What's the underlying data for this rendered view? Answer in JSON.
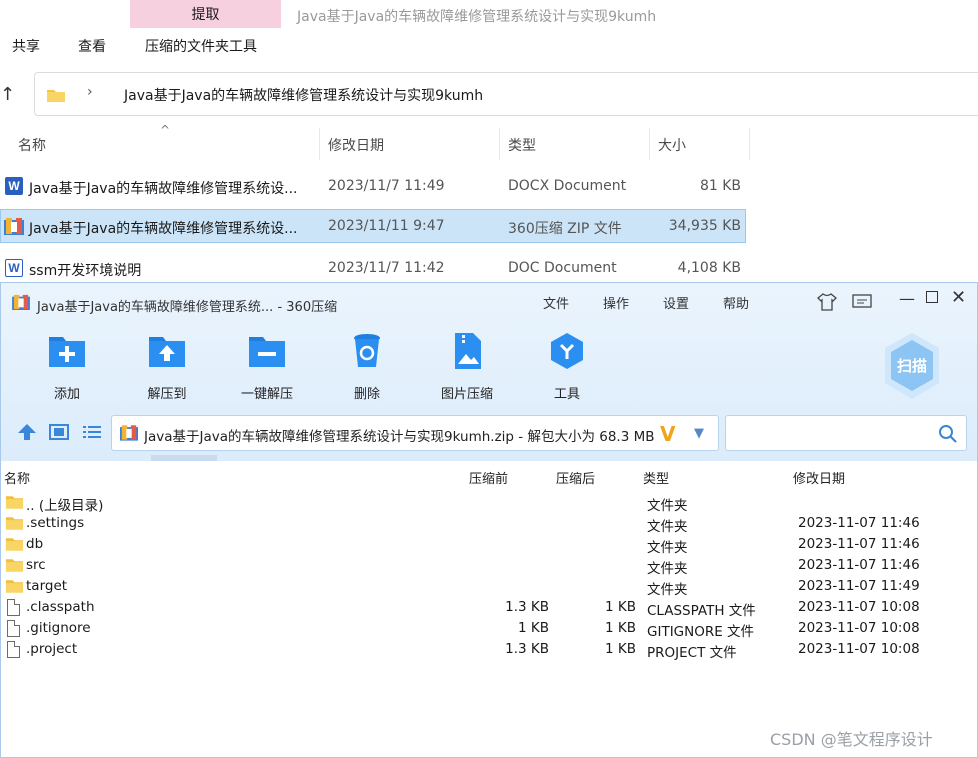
{
  "explorer": {
    "extract_tab": "提取",
    "window_title": "Java基于Java的车辆故障维修管理系统设计与实现9kumh",
    "menu": [
      "共享",
      "查看",
      "压缩的文件夹工具"
    ],
    "address_path": "Java基于Java的车辆故障维修管理系统设计与实现9kumh",
    "columns": [
      "名称",
      "修改日期",
      "类型",
      "大小"
    ],
    "files": [
      {
        "name": "Java基于Java的车辆故障维修管理系统设...",
        "date": "2023/11/7 11:49",
        "type": "DOCX Document",
        "size": "81 KB",
        "icon": "word-icon"
      },
      {
        "name": "Java基于Java的车辆故障维修管理系统设...",
        "date": "2023/11/11 9:47",
        "type": "360压缩 ZIP 文件",
        "size": "34,935 KB",
        "icon": "zip-icon"
      },
      {
        "name": "ssm开发环境说明",
        "date": "2023/11/7 11:42",
        "type": "DOC Document",
        "size": "4,108 KB",
        "icon": "doc-icon"
      }
    ]
  },
  "zip": {
    "title": "Java基于Java的车辆故障维修管理系统... - 360压缩",
    "menu": [
      "文件",
      "操作",
      "设置",
      "帮助"
    ],
    "toolbar": [
      "添加",
      "解压到",
      "一键解压",
      "删除",
      "图片压缩",
      "工具"
    ],
    "scan_label": "扫描",
    "path_text": "Java基于Java的车辆故障维修管理系统设计与实现9kumh.zip - 解包大小为 68.3 MB",
    "columns": [
      "名称",
      "压缩前",
      "压缩后",
      "类型",
      "修改日期"
    ],
    "rows": [
      {
        "name": ".. (上级目录)",
        "before": "",
        "after": "",
        "type": "文件夹",
        "date": "",
        "icon": "folder-icon"
      },
      {
        "name": ".settings",
        "before": "",
        "after": "",
        "type": "文件夹",
        "date": "2023-11-07 11:46",
        "icon": "folder-icon"
      },
      {
        "name": "db",
        "before": "",
        "after": "",
        "type": "文件夹",
        "date": "2023-11-07 11:46",
        "icon": "folder-icon"
      },
      {
        "name": "src",
        "before": "",
        "after": "",
        "type": "文件夹",
        "date": "2023-11-07 11:46",
        "icon": "folder-icon"
      },
      {
        "name": "target",
        "before": "",
        "after": "",
        "type": "文件夹",
        "date": "2023-11-07 11:49",
        "icon": "folder-icon"
      },
      {
        "name": ".classpath",
        "before": "1.3 KB",
        "after": "1 KB",
        "type": "CLASSPATH 文件",
        "date": "2023-11-07 10:08",
        "icon": "file-icon"
      },
      {
        "name": ".gitignore",
        "before": "1 KB",
        "after": "1 KB",
        "type": "GITIGNORE 文件",
        "date": "2023-11-07 10:08",
        "icon": "file-icon"
      },
      {
        "name": ".project",
        "before": "1.3 KB",
        "after": "1 KB",
        "type": "PROJECT 文件",
        "date": "2023-11-07 10:08",
        "icon": "file-icon"
      }
    ]
  },
  "watermark": "CSDN @笔文程序设计",
  "colors": {
    "selection": "#cce4f7",
    "zip_accent": "#2b8fe0",
    "extract_tab": "#f7d0e0"
  }
}
